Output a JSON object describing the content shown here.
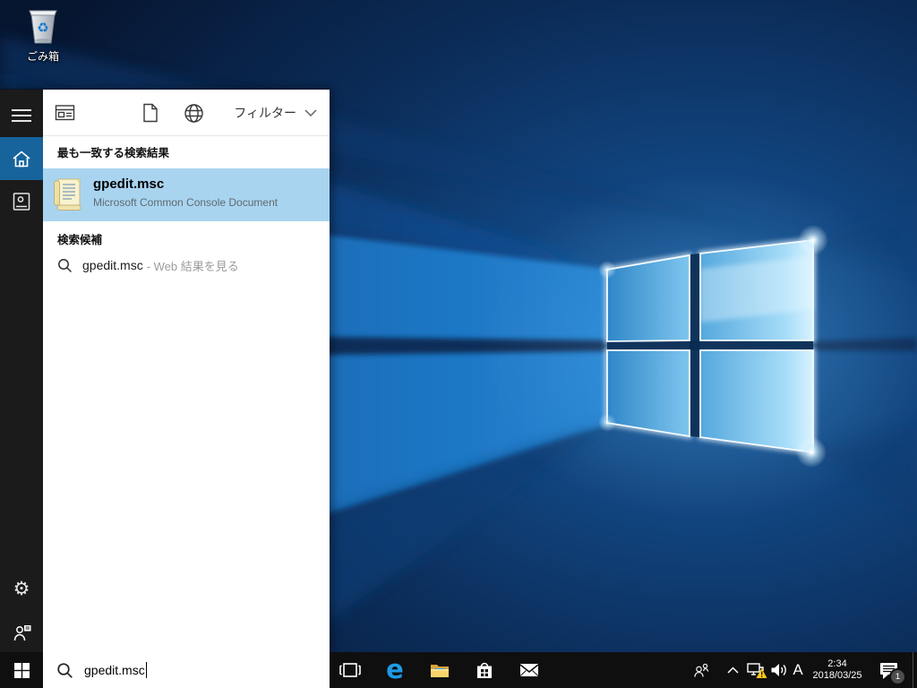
{
  "colors": {
    "accent_sidebar_active": "#17639c",
    "best_match_highlight": "#a9d4f0",
    "taskbar_bg": "#0f0f0f",
    "sidebar_bg": "#1b1b1b",
    "panel_bg": "#ffffff",
    "wallpaper_dark": "#071a36",
    "wallpaper_mid_blue": "#1d77c0",
    "edge_blue": "#1e9be6",
    "warning_yellow": "#fdc816"
  },
  "desktop": {
    "recycle_bin_label": "ごみ箱"
  },
  "icons": {
    "recycle_glyph": "♻",
    "settings_glyph": "⚙"
  },
  "search_flyout": {
    "filter_label": "フィルター",
    "best_match_header": "最も一致する検索結果",
    "best_match_title": "gpedit.msc",
    "best_match_subtitle": "Microsoft Common Console Document",
    "suggestions_header": "検索候補",
    "suggestion_query": "gpedit.msc",
    "suggestion_hint": "- Web 結果を見る",
    "sidebar_icon_names": [
      "menu",
      "home",
      "notebook",
      "settings",
      "feedback"
    ],
    "tab_icon_names": [
      "apps",
      "documents",
      "web"
    ]
  },
  "taskbar": {
    "search_value": "gpedit.msc",
    "edge_glyph": "e",
    "app_icon_names": [
      "task-view",
      "edge",
      "file-explorer",
      "store",
      "mail"
    ],
    "tray": {
      "icon_names": [
        "people",
        "chevron-up",
        "network-warning",
        "volume",
        "ime",
        "clock",
        "action-center"
      ],
      "ime_indicator": "A",
      "time": "2:34",
      "date": "2018/03/25",
      "notification_badge": "1"
    }
  }
}
